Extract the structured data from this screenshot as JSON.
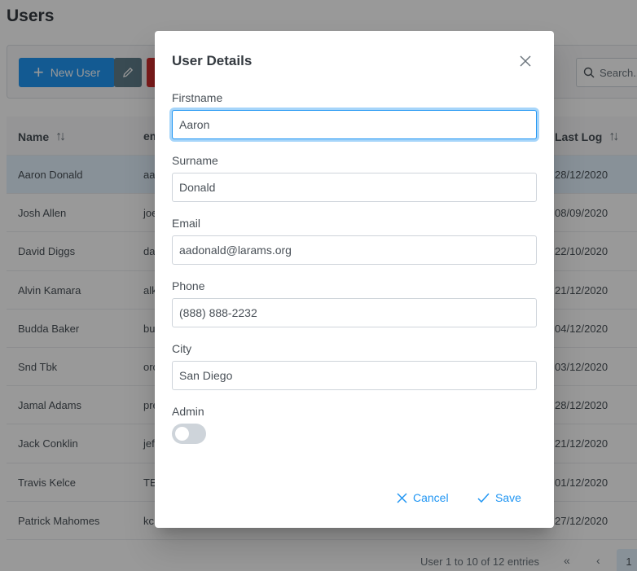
{
  "page": {
    "title": "Users"
  },
  "toolbar": {
    "new_label": "New User",
    "search_placeholder": "Search..."
  },
  "table": {
    "columns": {
      "name": "Name",
      "email": "email",
      "last_log": "Last Log"
    },
    "rows": [
      {
        "name": "Aaron Donald",
        "email": "aadonald@larams.org",
        "last_log": "28/12/2020"
      },
      {
        "name": "Josh Allen",
        "email": "joe",
        "last_log": "08/09/2020"
      },
      {
        "name": "David Diggs",
        "email": "da",
        "last_log": "22/10/2020"
      },
      {
        "name": "Alvin Kamara",
        "email": "alk",
        "last_log": "21/12/2020"
      },
      {
        "name": "Budda Baker",
        "email": "bu",
        "last_log": "04/12/2020"
      },
      {
        "name": "Snd Tbk",
        "email": "orc",
        "last_log": "03/12/2020"
      },
      {
        "name": "Jamal Adams",
        "email": "pre",
        "last_log": "28/12/2020"
      },
      {
        "name": "Jack Conklin",
        "email": "jef",
        "last_log": "21/12/2020"
      },
      {
        "name": "Travis Kelce",
        "email": "TE",
        "last_log": "01/12/2020"
      },
      {
        "name": "Patrick Mahomes",
        "email": "kc",
        "last_log": "27/12/2020"
      }
    ]
  },
  "paginator": {
    "summary": "User 1 to 10 of 12 entries",
    "current_page": "1"
  },
  "dialog": {
    "title": "User Details",
    "fields": {
      "firstname": {
        "label": "Firstname",
        "value": "Aaron"
      },
      "surname": {
        "label": "Surname",
        "value": "Donald"
      },
      "email": {
        "label": "Email",
        "value": "aadonald@larams.org"
      },
      "phone": {
        "label": "Phone",
        "value": "(888) 888-2232"
      },
      "city": {
        "label": "City",
        "value": "San Diego"
      }
    },
    "admin": {
      "label": "Admin",
      "checked": false
    },
    "cancel_label": "Cancel",
    "save_label": "Save"
  },
  "colors": {
    "primary": "#2196f3",
    "secondary": "#607d8b",
    "danger": "#d32f2f"
  }
}
